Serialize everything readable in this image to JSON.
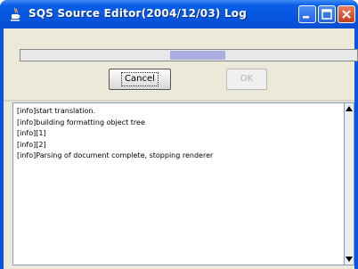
{
  "window": {
    "title": "SQS Source Editor(2004/12/03) Log",
    "icons": {
      "app": "java-cup-icon",
      "minimize": "minimize-icon",
      "maximize": "maximize-icon",
      "close": "close-icon"
    }
  },
  "progress": {
    "indeterminate": true,
    "fill_color": "#a9aee0"
  },
  "buttons": {
    "cancel_label": "Cancel",
    "ok_label": "OK"
  },
  "log": {
    "lines": [
      "[info]start translation.",
      "[info]building formatting object tree",
      "[info][1]",
      "[info][2]",
      "[info]Parsing of document complete, stopping renderer"
    ]
  },
  "colors": {
    "titlebar": "#0656e0",
    "client": "#ece9d8",
    "close_button": "#c4401f"
  }
}
